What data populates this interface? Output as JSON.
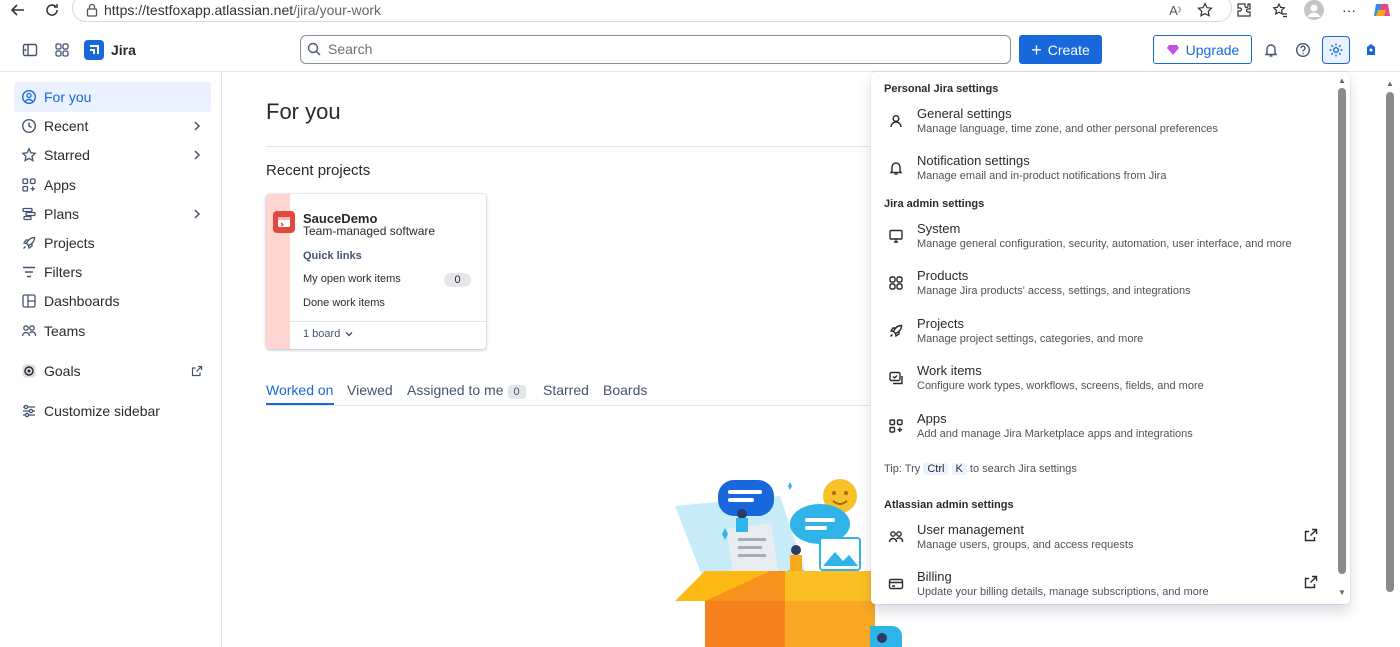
{
  "browser": {
    "url_host": "https://testfoxapp.atlassian.net",
    "url_path": "/jira/your-work"
  },
  "topnav": {
    "app_name": "Jira",
    "search_placeholder": "Search",
    "create_label": "Create",
    "upgrade_label": "Upgrade"
  },
  "sidebar": {
    "items": [
      {
        "label": "For you"
      },
      {
        "label": "Recent"
      },
      {
        "label": "Starred"
      },
      {
        "label": "Apps"
      },
      {
        "label": "Plans"
      },
      {
        "label": "Projects"
      },
      {
        "label": "Filters"
      },
      {
        "label": "Dashboards"
      },
      {
        "label": "Teams"
      },
      {
        "label": "Goals"
      },
      {
        "label": "Customize sidebar"
      }
    ]
  },
  "main": {
    "title": "For you",
    "recent_projects_title": "Recent projects",
    "project": {
      "name": "SauceDemo",
      "type": "Team-managed software",
      "quick_links": "Quick links",
      "link1": "My open work items",
      "link1_count": "0",
      "link2": "Done work items",
      "boards": "1 board"
    },
    "tabs": [
      {
        "label": "Worked on"
      },
      {
        "label": "Viewed"
      },
      {
        "label": "Assigned to me",
        "count": "0"
      },
      {
        "label": "Starred"
      },
      {
        "label": "Boards"
      }
    ]
  },
  "settings_menu": {
    "personal_heading": "Personal Jira settings",
    "admin_heading": "Jira admin settings",
    "atlassian_heading": "Atlassian admin settings",
    "items": [
      {
        "title": "General settings",
        "desc": "Manage language, time zone, and other personal preferences"
      },
      {
        "title": "Notification settings",
        "desc": "Manage email and in-product notifications from Jira"
      },
      {
        "title": "System",
        "desc": "Manage general configuration, security, automation, user interface, and more"
      },
      {
        "title": "Products",
        "desc": "Manage Jira products' access, settings, and integrations"
      },
      {
        "title": "Projects",
        "desc": "Manage project settings, categories, and more"
      },
      {
        "title": "Work items",
        "desc": "Configure work types, workflows, screens, fields, and more"
      },
      {
        "title": "Apps",
        "desc": "Add and manage Jira Marketplace apps and integrations"
      },
      {
        "title": "User management",
        "desc": "Manage users, groups, and access requests"
      },
      {
        "title": "Billing",
        "desc": "Update your billing details, manage subscriptions, and more"
      }
    ],
    "tip_prefix": "Tip: Try",
    "tip_key1": "Ctrl",
    "tip_key2": "K",
    "tip_suffix": "to search Jira settings"
  },
  "colors": {
    "brand": "#1868db",
    "project_avatar": "#e2483d",
    "card_stripe": "#ffd5d2"
  }
}
